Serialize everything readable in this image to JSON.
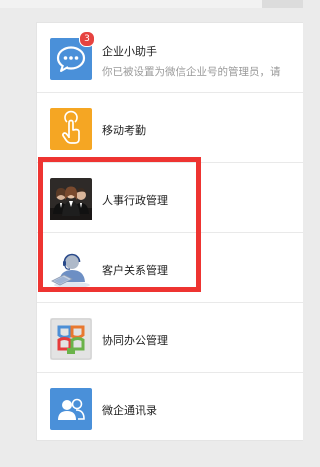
{
  "apps": [
    {
      "title": "企业小助手",
      "description": "你已被设置为微信企业号的管理员，请",
      "badge": "3",
      "icon": "chat-bubble-icon",
      "color": "#4a90d9"
    },
    {
      "title": "移动考勤",
      "icon": "touch-hand-icon",
      "color": "#f5a623"
    },
    {
      "title": "人事行政管理",
      "icon": "business-people-icon",
      "color": "#2a2a2a"
    },
    {
      "title": "客户关系管理",
      "icon": "customer-service-icon",
      "color": "#6a8fc7"
    },
    {
      "title": "协同办公管理",
      "icon": "collaboration-icon",
      "color": "#e8e8e8"
    },
    {
      "title": "微企通讯录",
      "icon": "contacts-icon",
      "color": "#4a90d9"
    }
  ],
  "highlight_color": "#ee3431"
}
